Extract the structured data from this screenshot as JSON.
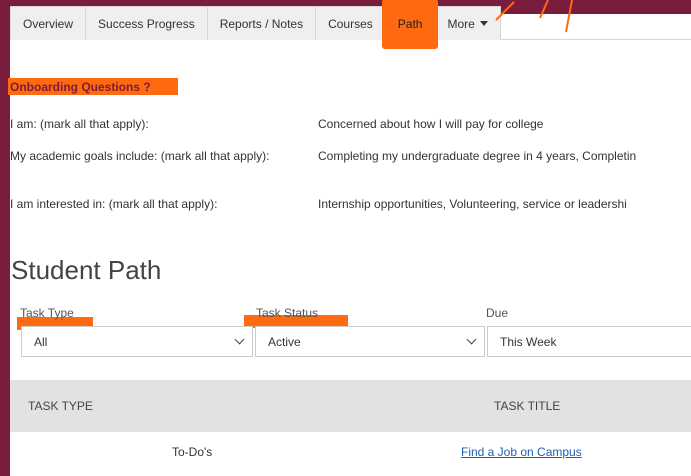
{
  "tabs": [
    {
      "label": "Overview"
    },
    {
      "label": "Success Progress"
    },
    {
      "label": "Reports / Notes"
    },
    {
      "label": "Courses"
    },
    {
      "label": "Path"
    },
    {
      "label": "More"
    }
  ],
  "onboarding": {
    "title": "Onboarding Questions ?",
    "rows": [
      {
        "question": "I am: (mark all that apply):",
        "answer": "Concerned about how I will pay for college"
      },
      {
        "question": "My academic goals include: (mark all that apply):",
        "answer": "Completing my undergraduate degree in 4 years, Completin"
      },
      {
        "question": "I am interested in: (mark all that apply):",
        "answer": "Internship opportunities, Volunteering, service or leadershi"
      }
    ]
  },
  "student_path": {
    "title": "Student Path",
    "filters": {
      "task_type": {
        "label": "Task Type",
        "value": "All"
      },
      "task_status": {
        "label": "Task Status",
        "value": "Active"
      },
      "due": {
        "label": "Due",
        "value": "This Week"
      }
    }
  },
  "table": {
    "columns": [
      "TASK TYPE",
      "TASK TITLE"
    ],
    "rows": [
      {
        "task_type": "To-Do's",
        "task_title": "Find a Job on Campus"
      }
    ]
  },
  "colors": {
    "background": "#7a1c3e",
    "highlight": "#ff6a10",
    "link": "#1f5fb0"
  }
}
